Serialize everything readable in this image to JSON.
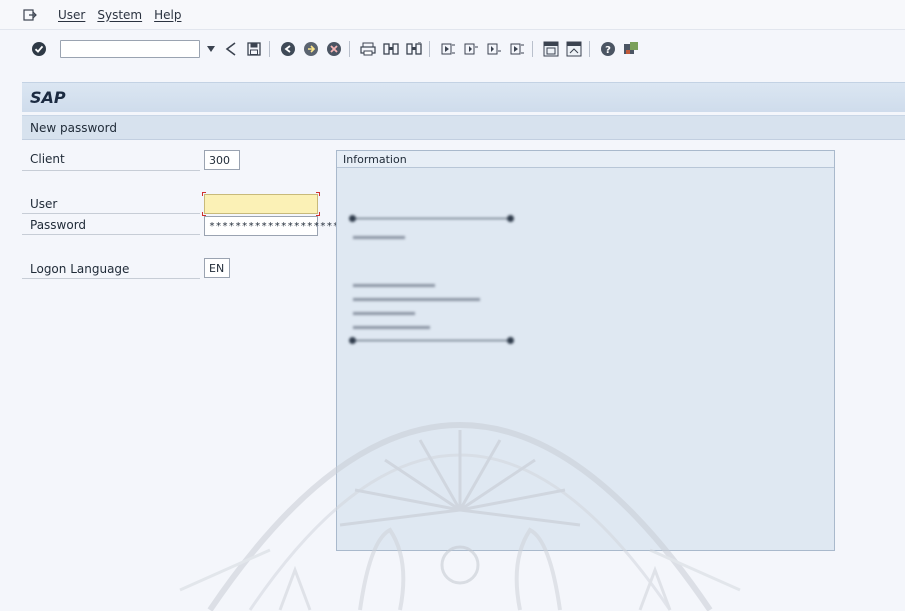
{
  "menu": {
    "items": [
      {
        "label": "User"
      },
      {
        "label": "System"
      },
      {
        "label": "Help"
      }
    ]
  },
  "toolbar": {
    "command_field_value": "",
    "buttons": [
      "enter-icon",
      "back-icon",
      "save-icon",
      "back-nav-icon",
      "exit-icon",
      "cancel-icon",
      "print-icon",
      "find-icon",
      "find-next-icon",
      "first-page-icon",
      "previous-page-icon",
      "next-page-icon",
      "last-page-icon",
      "create-session-icon",
      "shortcut-icon",
      "help-icon",
      "customize-layout-icon"
    ]
  },
  "header": {
    "app_title": "SAP",
    "screen_title": "New password"
  },
  "logon": {
    "client_label": "Client",
    "client_value": "300",
    "user_label": "User",
    "user_value": "",
    "password_label": "Password",
    "password_mask": "********************",
    "language_label": "Logon Language",
    "language_value": "EN"
  },
  "info": {
    "title": "Information"
  },
  "colors": {
    "title_bar": "#d7e2ee",
    "focused_field": "#fbf1b6",
    "info_panel": "#dfe8f2"
  }
}
